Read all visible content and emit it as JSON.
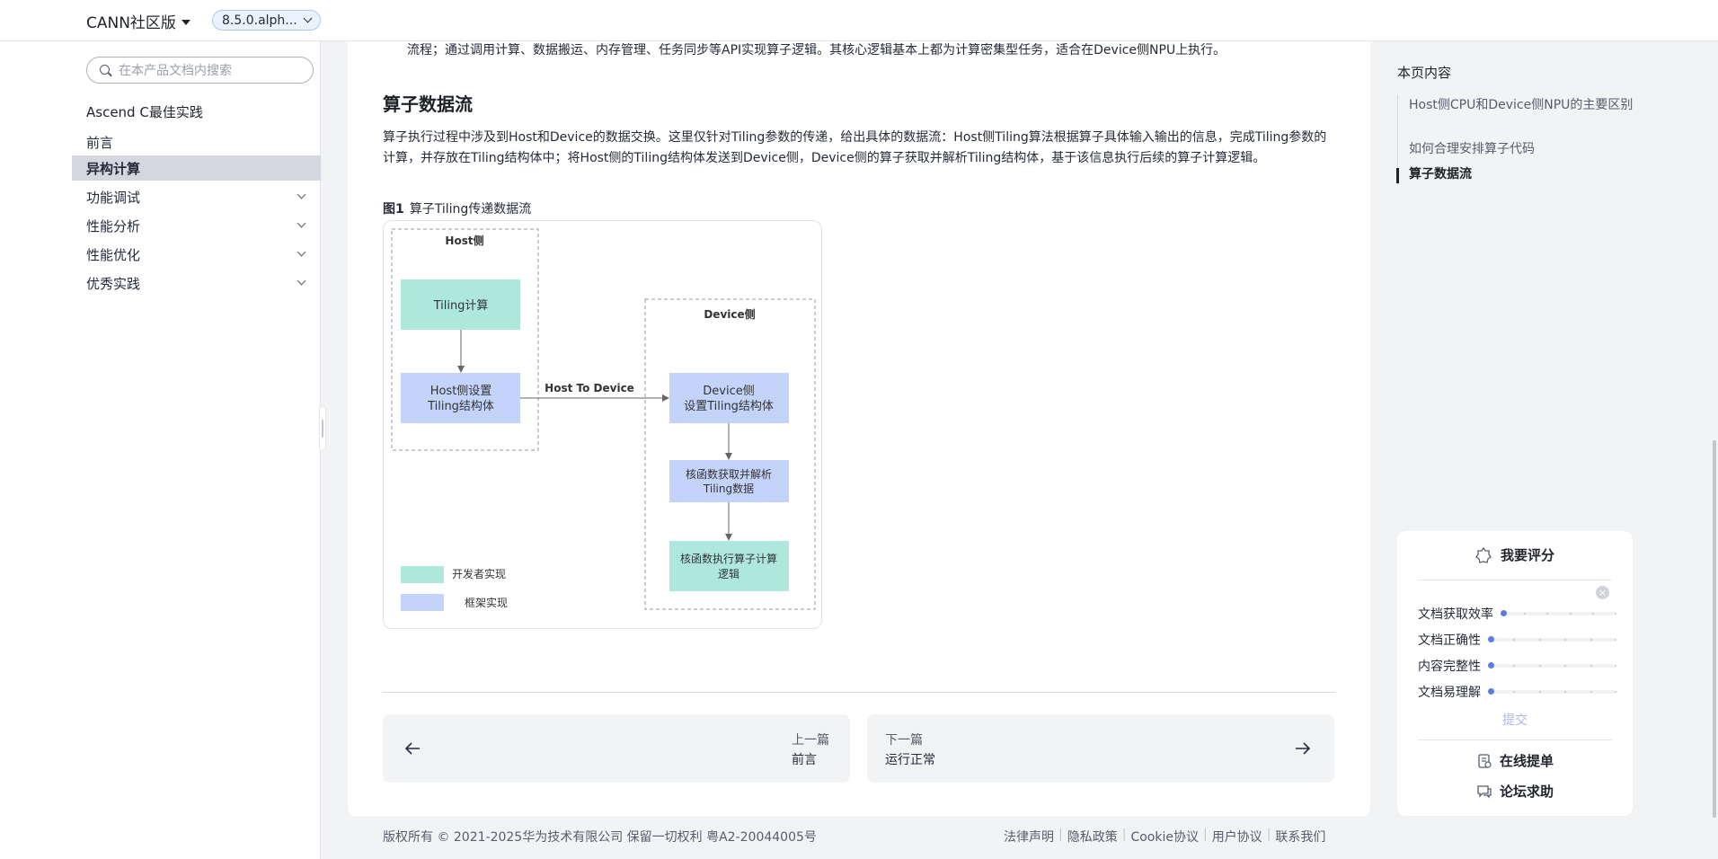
{
  "header": {
    "brand": "CANN社区版",
    "version": "8.5.0.alph..."
  },
  "sidebar": {
    "search_placeholder": "在本产品文档内搜索",
    "title": "Ascend C最佳实践",
    "items": [
      {
        "label": "前言",
        "active": false,
        "expandable": false
      },
      {
        "label": "异构计算",
        "active": true,
        "expandable": false
      },
      {
        "label": "功能调试",
        "active": false,
        "expandable": true
      },
      {
        "label": "性能分析",
        "active": false,
        "expandable": true
      },
      {
        "label": "性能优化",
        "active": false,
        "expandable": true
      },
      {
        "label": "优秀实践",
        "active": false,
        "expandable": true
      }
    ]
  },
  "content": {
    "intro": "流程；通过调用计算、数据搬运、内存管理、任务同步等API实现算子逻辑。其核心逻辑基本上都为计算密集型任务，适合在Device侧NPU上执行。",
    "heading": "算子数据流",
    "paragraph": "算子执行过程中涉及到Host和Device的数据交换。这里仅针对Tiling参数的传递，给出具体的数据流：Host侧Tiling算法根据算子具体输入输出的信息，完成Tiling参数的计算，并存放在Tiling结构体中；将Host侧的Tiling结构体发送到Device侧，Device侧的算子获取并解析Tiling结构体，基于该信息执行后续的算子计算逻辑。",
    "figure_label": "图1",
    "figure_caption": "算子Tiling传递数据流",
    "diagram": {
      "host_group": "Host侧",
      "device_group": "Device侧",
      "tiling_calc": "Tiling计算",
      "host_set_1": "Host侧设置",
      "host_set_2": "Tiling结构体",
      "edge_label": "Host To Device",
      "device_set_1": "Device侧",
      "device_set_2": "设置Tiling结构体",
      "kernel_parse_1": "核函数获取并解析",
      "kernel_parse_2": "Tiling数据",
      "kernel_exec_1": "核函数执行算子计算",
      "kernel_exec_2": "逻辑",
      "legend_dev": "开发者实现",
      "legend_fw": "框架实现",
      "color_dev": "#aee8dd",
      "color_fw": "#c3d3fa"
    },
    "prev": {
      "small": "上一篇",
      "title": "前言"
    },
    "next": {
      "small": "下一篇",
      "title": "运行正常"
    }
  },
  "toc": {
    "title": "本页内容",
    "items": [
      {
        "label": "Host侧CPU和Device侧NPU的主要区别",
        "active": false
      },
      {
        "label": "如何合理安排算子代码",
        "active": false
      },
      {
        "label": "算子数据流",
        "active": true
      }
    ]
  },
  "rating": {
    "title": "我要评分",
    "close": "×",
    "rows": [
      {
        "label": "文档获取效率",
        "value": 0
      },
      {
        "label": "文档正确性",
        "value": 0
      },
      {
        "label": "内容完整性",
        "value": 0
      },
      {
        "label": "文档易理解",
        "value": 0
      }
    ],
    "submit": "提交",
    "online_ticket": "在线提单",
    "forum_help": "论坛求助"
  },
  "footer": {
    "copyright": "版权所有 © 2021-2025华为技术有限公司 保留一切权利 粤A2-20044005号",
    "links": [
      "法律声明",
      "隐私政策",
      "Cookie协议",
      "用户协议",
      "联系我们"
    ]
  }
}
